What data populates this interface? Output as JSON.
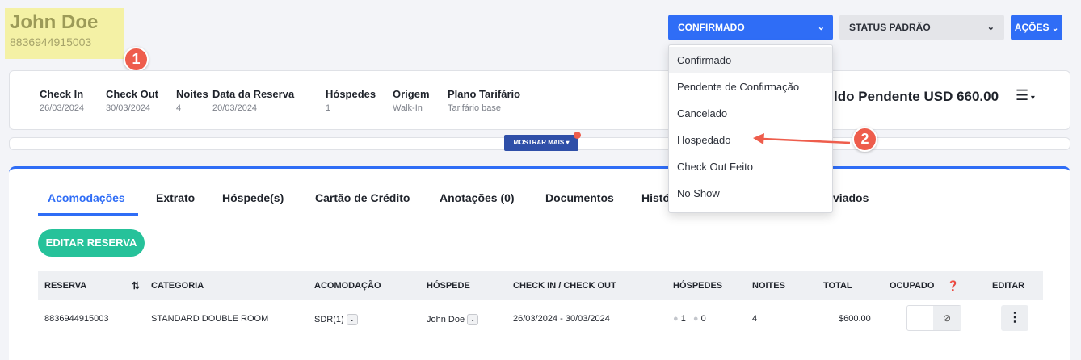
{
  "guest": {
    "name": "John Doe",
    "id": "8836944915003"
  },
  "step_badges": [
    "1",
    "2"
  ],
  "top_actions": {
    "status_label": "CONFIRMADO",
    "default_status_label": "STATUS PADRÃO",
    "actions_label": "AÇÕES"
  },
  "status_menu": {
    "items": [
      "Confirmado",
      "Pendente de Confirmação",
      "Cancelado",
      "Hospedado",
      "Check Out Feito",
      "No Show"
    ],
    "selected": "Confirmado"
  },
  "summary": {
    "check_in": {
      "label": "Check In",
      "value": "26/03/2024"
    },
    "check_out": {
      "label": "Check Out",
      "value": "30/03/2024"
    },
    "nights": {
      "label": "Noites",
      "value": "4"
    },
    "booking_date": {
      "label": "Data da Reserva",
      "value": "20/03/2024"
    },
    "guests": {
      "label": "Hóspedes",
      "value": "1"
    },
    "origin": {
      "label": "Origem",
      "value": "Walk-In"
    },
    "rate_plan": {
      "label": "Plano Tarifário",
      "value": "Tarifário base"
    },
    "balance": "ldo Pendente USD 660.00"
  },
  "show_more_label": "MOSTRAR MAIS",
  "tabs": [
    {
      "label": "Acomodações",
      "active": true
    },
    {
      "label": "Extrato"
    },
    {
      "label": "Hóspede(s)"
    },
    {
      "label": "Cartão de Crédito"
    },
    {
      "label": "Anotações (0)"
    },
    {
      "label": "Documentos"
    },
    {
      "label": "Histó"
    },
    {
      "label": "viados"
    }
  ],
  "edit_reservation_label": "EDITAR RESERVA",
  "table": {
    "columns": [
      "RESERVA",
      "CATEGORIA",
      "ACOMODAÇÃO",
      "HÓSPEDE",
      "CHECK IN / CHECK OUT",
      "HÓSPEDES",
      "NOITES",
      "TOTAL",
      "OCUPADO",
      "EDITAR"
    ],
    "rows": [
      {
        "reservation": "8836944915003",
        "category": "STANDARD DOUBLE ROOM",
        "room": "SDR(1)",
        "guest": "John Doe",
        "dates": "26/03/2024 - 30/03/2024",
        "adults": "1",
        "children": "0",
        "nights": "4",
        "total": "$600.00"
      }
    ]
  },
  "colors": {
    "primary": "#2f6df6",
    "accent_green": "#26c29a",
    "badge_red": "#ee5d4c",
    "highlight": "#f4f1a5"
  }
}
